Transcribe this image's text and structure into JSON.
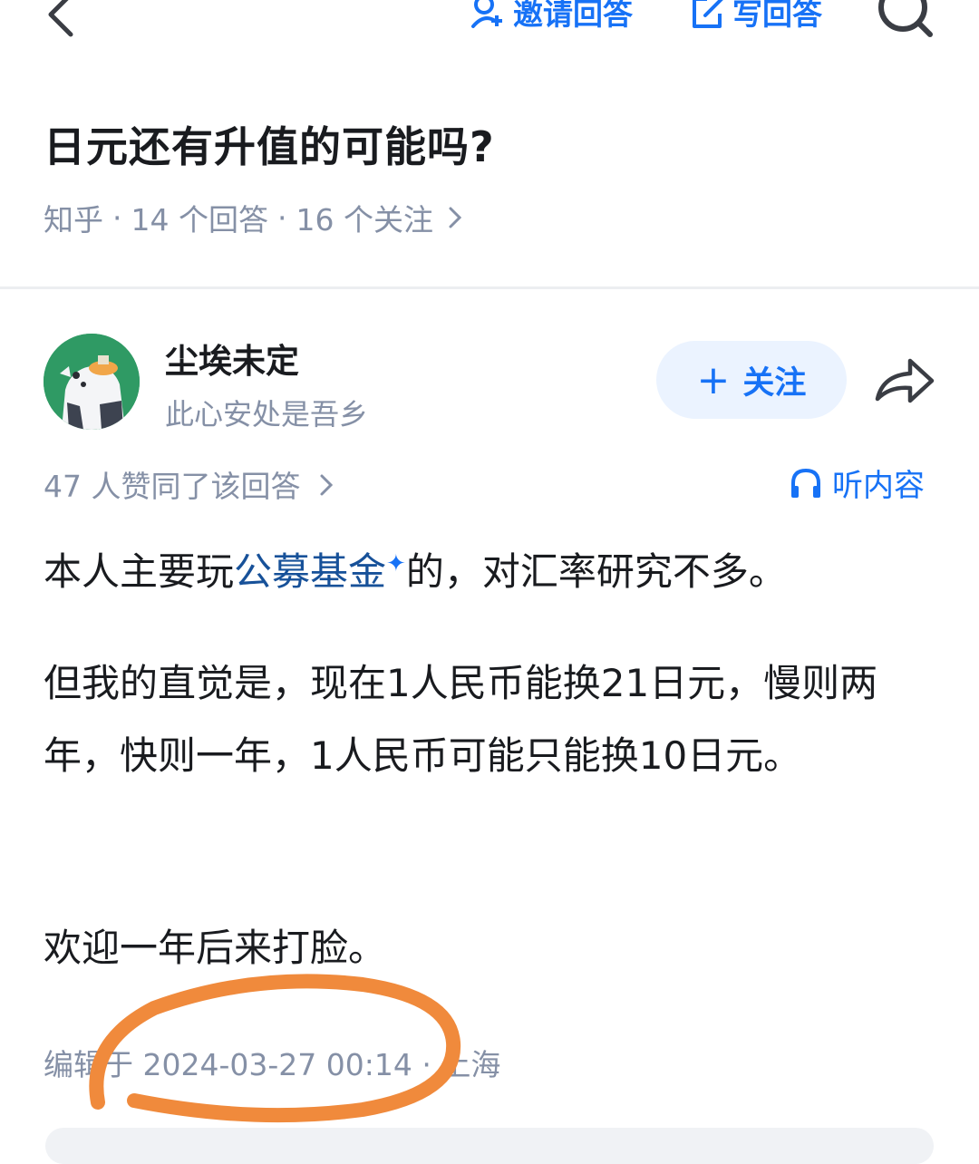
{
  "header": {
    "invite_label": "邀请回答",
    "write_label": "写回答",
    "accent": "#1772f6"
  },
  "question": {
    "title": "日元还有升值的可能吗?",
    "source": "知乎",
    "answers": "14 个回答",
    "followers": "16 个关注"
  },
  "author": {
    "name": "尘埃未定",
    "bio": "此心安处是吾乡",
    "follow_label": "关注"
  },
  "answer": {
    "votes": "47 人赞同了该回答",
    "listen_label": "听内容",
    "p1_pre": "本人主要玩",
    "p1_link": "公募基金",
    "p1_post": "的，对汇率研究不多。",
    "p2": "但我的直觉是，现在1人民币能换21日元，慢则两年，快则一年，1人民币可能只能换10日元。",
    "p3": "欢迎一年后来打脸。",
    "edited": "编辑于 2024-03-27 00:14 · 上海"
  },
  "annotation_color": "#f08a3c"
}
